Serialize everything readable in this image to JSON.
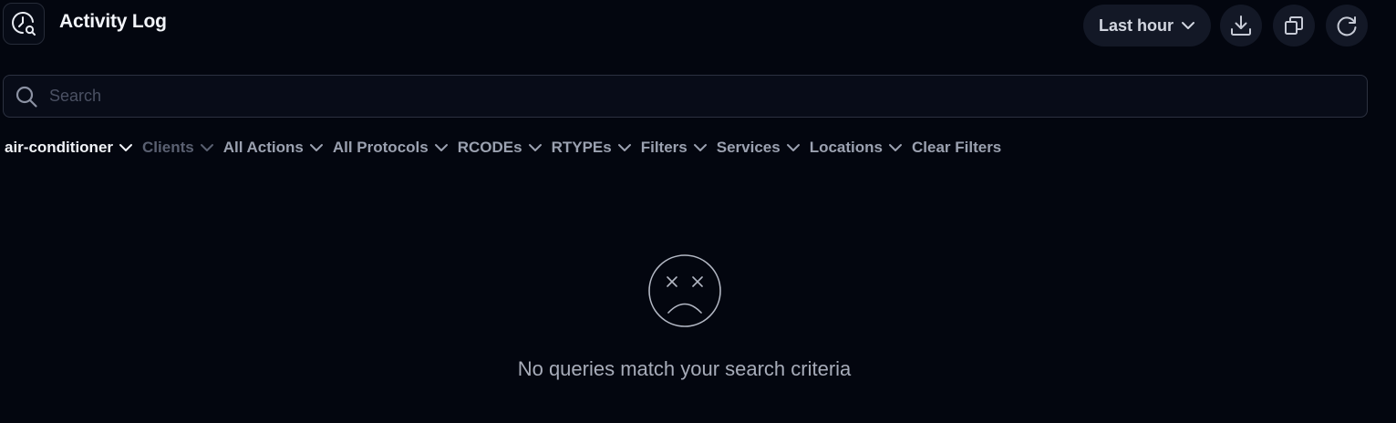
{
  "header": {
    "title": "Activity Log",
    "app_icon": "clock-search-icon"
  },
  "toolbar": {
    "time_range": {
      "label": "Last hour",
      "icon": "chevron-down-icon"
    },
    "download_icon": "download-icon",
    "copy_icon": "copy-icon",
    "refresh_icon": "refresh-icon"
  },
  "search": {
    "placeholder": "Search",
    "value": "",
    "icon": "search-icon"
  },
  "filters": [
    {
      "label": "air-conditioner",
      "state": "active"
    },
    {
      "label": "Clients",
      "state": "disabled"
    },
    {
      "label": "All Actions",
      "state": "normal"
    },
    {
      "label": "All Protocols",
      "state": "normal"
    },
    {
      "label": "RCODEs",
      "state": "normal"
    },
    {
      "label": "RTYPEs",
      "state": "normal"
    },
    {
      "label": "Filters",
      "state": "normal"
    },
    {
      "label": "Services",
      "state": "normal"
    },
    {
      "label": "Locations",
      "state": "normal"
    }
  ],
  "clear_filters_label": "Clear Filters",
  "empty_state": {
    "icon": "sad-face-icon",
    "message": "No queries match your search criteria"
  },
  "colors": {
    "background": "#03060f",
    "surface": "#131826",
    "border": "#2c3140",
    "text_primary": "#f3f5fa",
    "text_secondary": "#9ba1b0",
    "text_muted": "#5a6071"
  }
}
